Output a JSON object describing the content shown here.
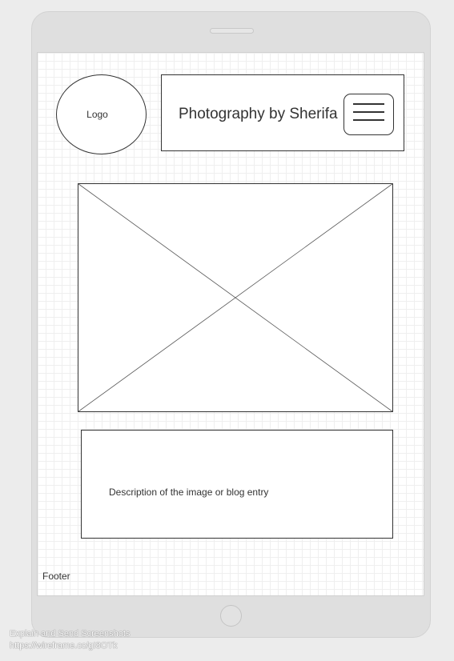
{
  "logo": {
    "label": "Logo"
  },
  "header": {
    "title": "Photography by Sherifa",
    "menu_icon": "hamburger-menu-icon"
  },
  "hero": {
    "placeholder_icon": "image-placeholder-icon"
  },
  "description": {
    "text": "Description of the image or blog entry"
  },
  "footer": {
    "label": "Footer"
  },
  "watermark": {
    "line1": "Explain and Send Screenshots",
    "line2": "https://wireframe.cc/gI8OTk"
  }
}
